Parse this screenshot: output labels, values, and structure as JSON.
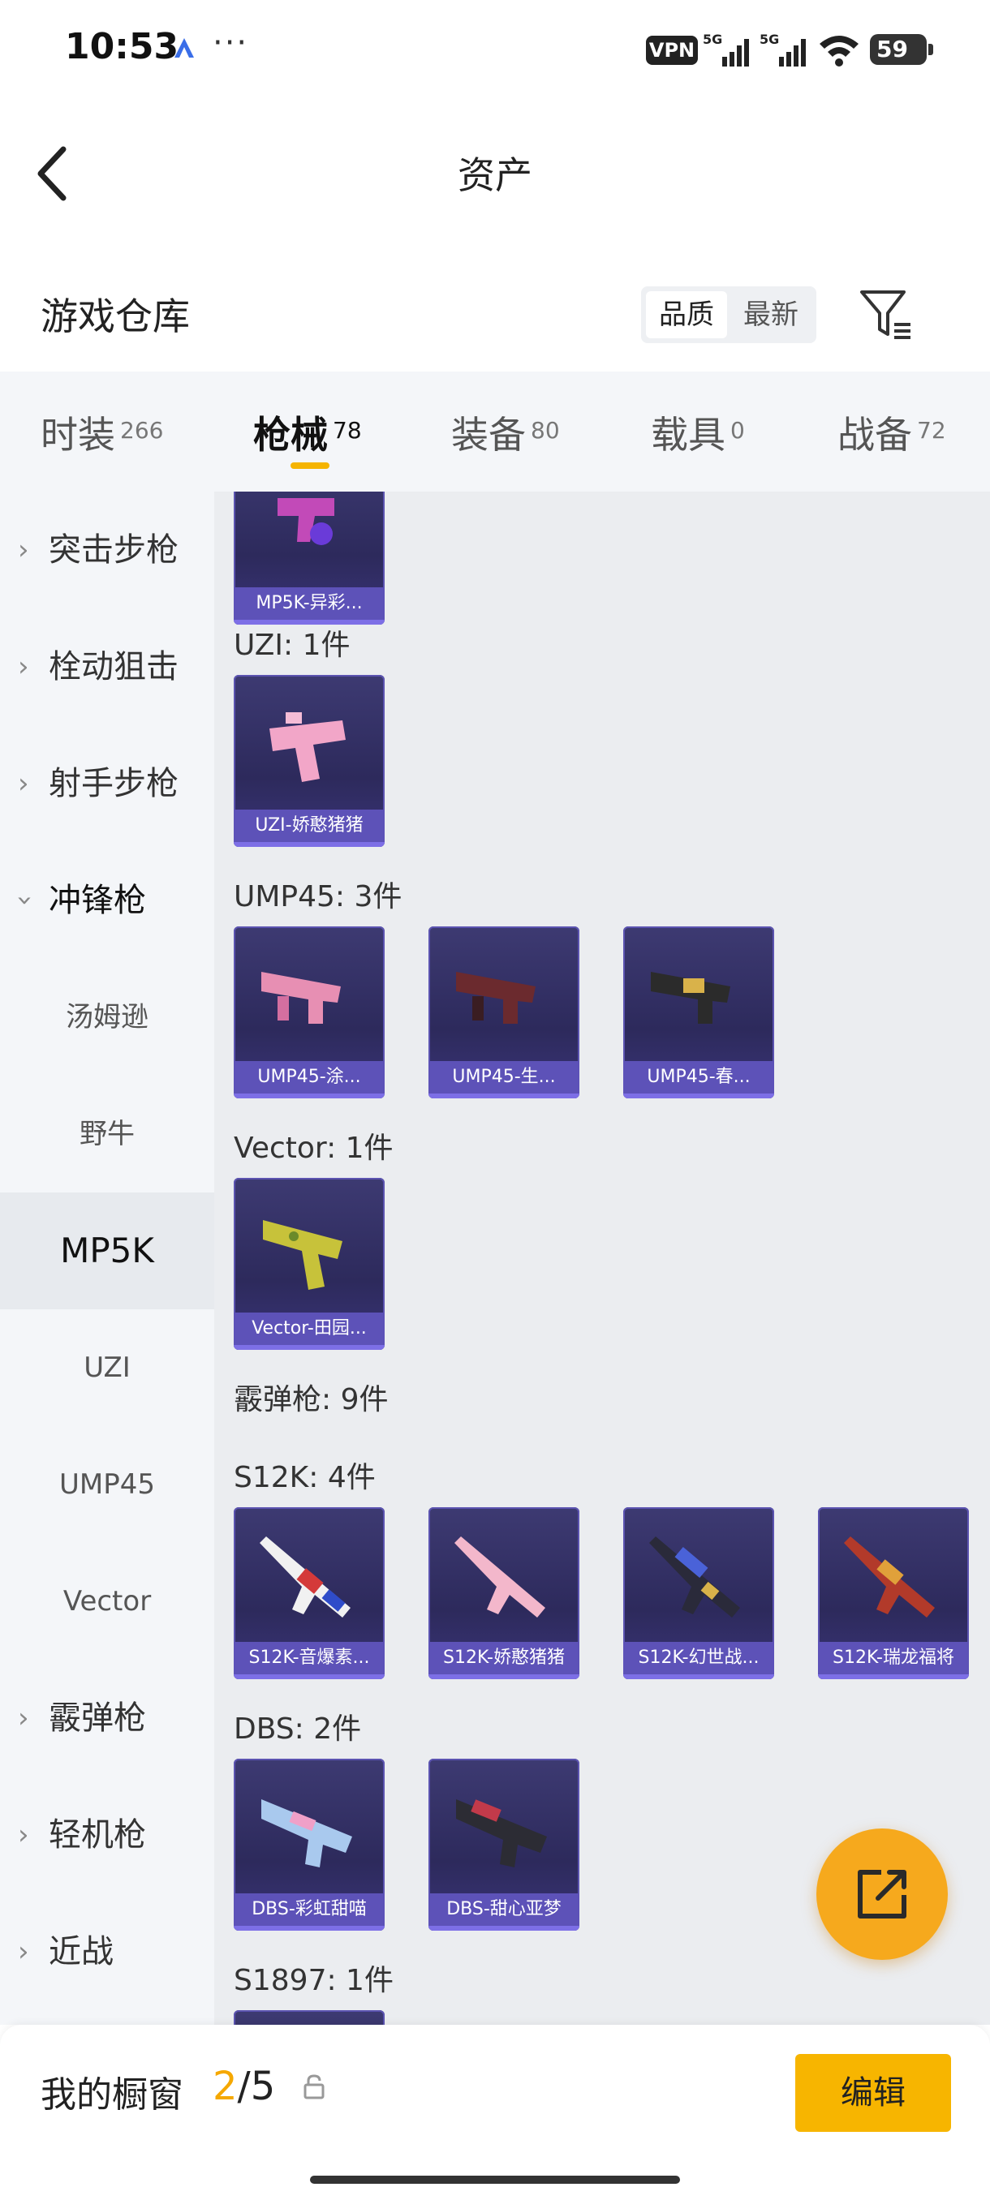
{
  "status_bar": {
    "time": "10:53",
    "vpn": "VPN",
    "net1": "5G",
    "net2": "5G",
    "battery": "59"
  },
  "header": {
    "title": "资产"
  },
  "section": {
    "title": "游戏仓库",
    "sort_quality": "品质",
    "sort_newest": "最新"
  },
  "tabs": [
    {
      "label": "时装",
      "count": "266"
    },
    {
      "label": "枪械",
      "count": "78"
    },
    {
      "label": "装备",
      "count": "80"
    },
    {
      "label": "载具",
      "count": "0"
    },
    {
      "label": "战备",
      "count": "72"
    }
  ],
  "sidebar": {
    "categories": [
      "突击步枪",
      "栓动狙击",
      "射手步枪",
      "冲锋枪",
      "霰弹枪",
      "轻机枪",
      "近战"
    ],
    "subcategories": [
      "汤姆逊",
      "野牛",
      "MP5K",
      "UZI",
      "UMP45",
      "Vector"
    ]
  },
  "content": {
    "partial_card": "MP5K-异彩...",
    "groups": [
      {
        "title": "UZI: 1件",
        "items": [
          "UZI-娇憨猪猪"
        ]
      },
      {
        "title": "UMP45: 3件",
        "items": [
          "UMP45-涂...",
          "UMP45-生...",
          "UMP45-春..."
        ]
      },
      {
        "title": "Vector: 1件",
        "items": [
          "Vector-田园..."
        ]
      },
      {
        "title": "霰弹枪: 9件",
        "items": []
      },
      {
        "title": "S12K: 4件",
        "items": [
          "S12K-音爆素...",
          "S12K-娇憨猪猪",
          "S12K-幻世战...",
          "S12K-瑞龙福将"
        ]
      },
      {
        "title": "DBS: 2件",
        "items": [
          "DBS-彩虹甜喵",
          "DBS-甜心亚梦"
        ]
      },
      {
        "title": "S1897: 1件",
        "items": []
      }
    ]
  },
  "bottom": {
    "label": "我的橱窗",
    "current": "2",
    "separator": "/",
    "total": "5",
    "edit": "编辑"
  },
  "colors": {
    "accent": "#f5b400",
    "card_bg": "#2d2a5c",
    "card_caption": "#5d52b8"
  }
}
